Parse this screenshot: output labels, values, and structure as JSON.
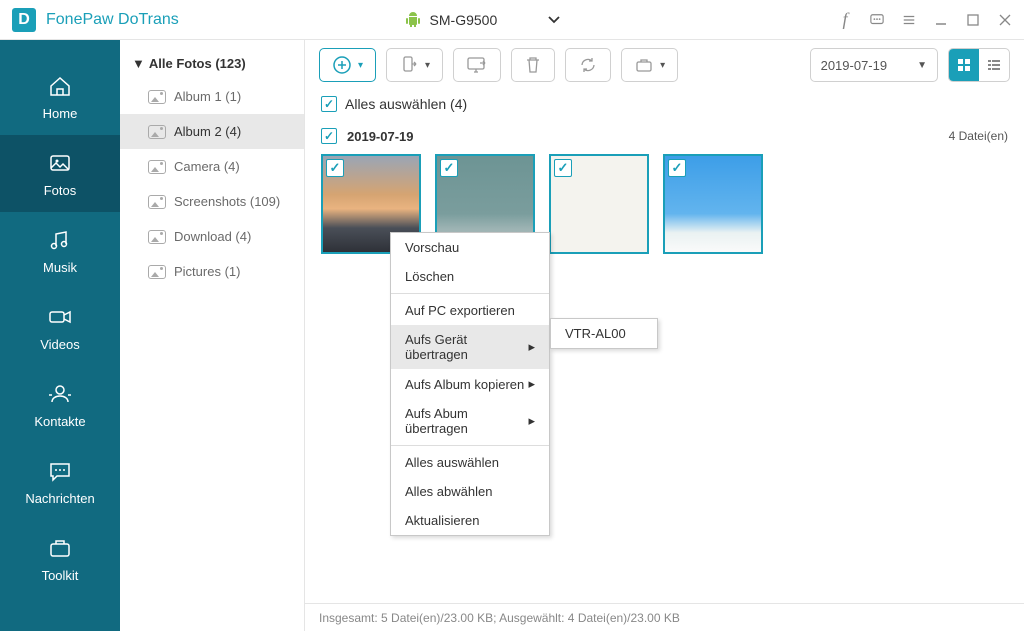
{
  "app_title": "FonePaw DoTrans",
  "device": {
    "name": "SM-G9500"
  },
  "sidebar": [
    {
      "label": "Home"
    },
    {
      "label": "Fotos"
    },
    {
      "label": "Musik"
    },
    {
      "label": "Videos"
    },
    {
      "label": "Kontakte"
    },
    {
      "label": "Nachrichten"
    },
    {
      "label": "Toolkit"
    }
  ],
  "tree": {
    "root": "Alle Fotos (123)",
    "items": [
      {
        "label": "Album 1 (1)"
      },
      {
        "label": "Album 2 (4)"
      },
      {
        "label": "Camera (4)"
      },
      {
        "label": "Screenshots (109)"
      },
      {
        "label": "Download (4)"
      },
      {
        "label": "Pictures (1)"
      }
    ]
  },
  "toolbar": {
    "date": "2019-07-19"
  },
  "select_all_label": "Alles auswählen (4)",
  "group": {
    "date": "2019-07-19",
    "count": "4 Datei(en)"
  },
  "context_menu": [
    "Vorschau",
    "Löschen",
    "Auf PC exportieren",
    "Aufs Gerät übertragen",
    "Aufs Album kopieren",
    "Aufs Abum übertragen",
    "Alles auswählen",
    "Alles abwählen",
    "Aktualisieren"
  ],
  "submenu_device": "VTR-AL00",
  "status": "Insgesamt: 5 Datei(en)/23.00 KB; Ausgewählt: 4 Datei(en)/23.00 KB"
}
